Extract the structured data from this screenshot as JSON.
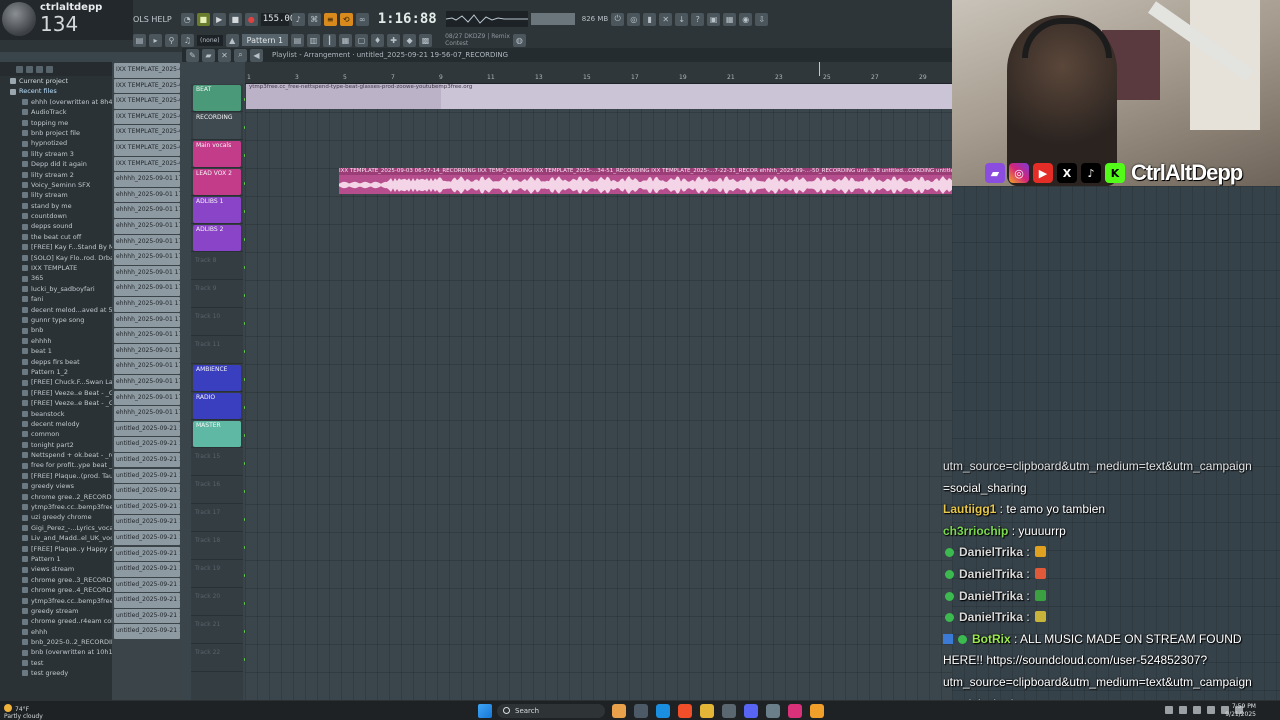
{
  "overlay": {
    "username": "ctrlaltdepp",
    "viewer_count": "134",
    "handle": "CtrlAltDepp"
  },
  "toolbar": {
    "menu_label": "OLS HELP",
    "tempo": "155.000",
    "time": "1:16:88",
    "cpu": "826 MB",
    "pattern": "Pattern 1",
    "snap": "(none)",
    "hint_line1": "08/27 DKDZ9 | Remix",
    "hint_line2": "Contest"
  },
  "playlist": {
    "title": "Playlist - Arrangement · untitled_2025-09-21 19-56-07_RECORDING",
    "bars": [
      "1",
      "3",
      "5",
      "7",
      "9",
      "11",
      "13",
      "15",
      "17",
      "19",
      "21",
      "23",
      "25",
      "27",
      "29"
    ],
    "clip_beat_label": "ytmp3free.cc_free-nettspend-type-beat-glasses-prod-zoowe-youtubemp3free.org",
    "clip_vocal_label": "IXX TEMPLATE_2025-09-03 06-57-14_RECORDING    IXX TEMP_CORDING    IXX TEMPLATE_2025-...34-51_RECORDING    IXX TEMPLATE_2025-...7-22-31_RECOR    ehhhh_2025-09-...-50_RECORDING    unti...38    untitled...CORDING    untitled_2025"
  },
  "tracks": [
    {
      "name": "BEAT",
      "color": "#4a9a7a"
    },
    {
      "name": "RECORDING",
      "color": "#3f4a50"
    },
    {
      "name": "Main vocals",
      "color": "#c33c8a"
    },
    {
      "name": "LEAD VOX 2",
      "color": "#c33c8a"
    },
    {
      "name": "ADLIBS 1",
      "color": "#8a44c8"
    },
    {
      "name": "ADLIBS 2",
      "color": "#8a44c8"
    },
    {
      "name": "Track 8",
      "color": ""
    },
    {
      "name": "Track 9",
      "color": ""
    },
    {
      "name": "Track 10",
      "color": ""
    },
    {
      "name": "Track 11",
      "color": ""
    },
    {
      "name": "AMBIENCE",
      "color": "#3a3fc0"
    },
    {
      "name": "RADIO",
      "color": "#3a3fc0"
    },
    {
      "name": "MASTER",
      "color": "#5fb8a4"
    },
    {
      "name": "Track 15",
      "color": ""
    },
    {
      "name": "Track 16",
      "color": ""
    },
    {
      "name": "Track 17",
      "color": ""
    },
    {
      "name": "Track 18",
      "color": ""
    },
    {
      "name": "Track 19",
      "color": ""
    },
    {
      "name": "Track 20",
      "color": ""
    },
    {
      "name": "Track 21",
      "color": ""
    },
    {
      "name": "Track 22",
      "color": ""
    }
  ],
  "browser": {
    "headers": [
      "Current project",
      "Recent files"
    ],
    "items": [
      "ehhh (overwritten at 8h42)",
      "AudioTrack",
      "topping me",
      "bnb project file",
      "hypnotized",
      "lilty stream 3",
      "Depp did it again",
      "lilty stream 2",
      "Voicy_Seminn SFX",
      "lilty stream",
      "stand by me",
      "countdown",
      "depps sound",
      "the beat cut off",
      "[FREE] Kay F...Stand By Me...",
      "[SOLO] Kay Flo..rod. Drbayk)",
      "IXX TEMPLATE",
      "365",
      "lucki_by_sadboyfari",
      "fani",
      "decent melod...aved at 5h27)",
      "gunnr type song",
      "bnb",
      "ehhhh",
      "beat 1",
      "depps firs beat",
      "Pattern 1_2",
      "[FREE] Chuck.F...Swan Lake_",
      "[FREE] Veeze..e Beat - _Go_1",
      "[FREE] Veeze..e Beat - _Go_",
      "beanstock",
      "decent melody",
      "common",
      "tonight part2",
      "Nettspend + ok.beat - _roll",
      "free for profit..ype beat _ss",
      "[FREE] Plaque..(prod. Taurs)",
      "greedy views",
      "chrome gree..2_RECORDING",
      "ytmp3free.cc..bemp3free.org",
      "uzi greedy chrome",
      "Gigi_Perez_-...Lyrics_vocal",
      "Liv_and_Madd..el_UK_vocal",
      "[FREE] Plaque..y Happy 2025",
      "Pattern 1",
      "views stream",
      "chrome gree..3_RECORDING",
      "chrome gree..4_RECORDING",
      "ytmp3free.cc..bemp3free.org",
      "greedy stream",
      "chrome greed..r4eam collab",
      "ehhh",
      "bnb_2025-0..2_RECORDING",
      "bnb (overwritten at 10h11)",
      "test",
      "test greedy"
    ]
  },
  "clips": [
    "IXX TEMPLATE_2025-09-...",
    "IXX TEMPLATE_2025-09-...",
    "IXX TEMPLATE_2025-09-...",
    "IXX TEMPLATE_2025-09-...",
    "IXX TEMPLATE_2025-09-...",
    "IXX TEMPLATE_2025-09-...",
    "IXX TEMPLATE_2025-09-...",
    "ehhhh_2025-09-01 17-44..",
    "ehhhh_2025-09-01 17-44..",
    "ehhhh_2025-09-01 17-45..",
    "ehhhh_2025-09-01 17-46..",
    "ehhhh_2025-09-01 17-46..",
    "ehhhh_2025-09-01 17-47..",
    "ehhhh_2025-09-01 17-47..",
    "ehhhh_2025-09-01 17-49..",
    "ehhhh_2025-09-01 17-49..",
    "ehhhh_2025-09-01 17-50..",
    "ehhhh_2025-09-01 17-52..",
    "ehhhh_2025-09-01 17-53..",
    "ehhhh_2025-09-01 17-53..",
    "ehhhh_2025-09-01 17-54..",
    "ehhhh_2025-09-01 17-55..",
    "ehhhh_2025-09-01 17-56..",
    "untitled_2025-09-21 19-..",
    "untitled_2025-09-21 19-..",
    "untitled_2025-09-21 19-..",
    "untitled_2025-09-21 19-..",
    "untitled_2025-09-21 19-..",
    "untitled_2025-09-21 19-..",
    "untitled_2025-09-21 19-..",
    "untitled_2025-09-21 19-..",
    "untitled_2025-09-21 19-..",
    "untitled_2025-09-21 19-..",
    "untitled_2025-09-21 19-..",
    "untitled_2025-09-21 19-..",
    "untitled_2025-09-21 19-..",
    "untitled_2025-09-21 19-.."
  ],
  "chat": {
    "messages": [
      {
        "user": "",
        "text": "utm_source=clipboard&utm_medium=text&utm_campaign",
        "color": "#ffffff",
        "badge": false,
        "partial": true
      },
      {
        "user": "",
        "text": "=social_sharing",
        "color": "#ffffff",
        "badge": false,
        "partial": false
      },
      {
        "user": "Lautiigg1",
        "text": "te amo yo tambien",
        "color": "#e8c84a",
        "badge": false,
        "partial": false
      },
      {
        "user": "ch3rriochip",
        "text": "yuuuurrp",
        "color": "#7bd94f",
        "badge": false,
        "partial": false
      },
      {
        "user": "DanielTrika",
        "text": "",
        "color": "#d8d8d8",
        "badge": true,
        "emote": "#e0a020",
        "partial": false
      },
      {
        "user": "DanielTrika",
        "text": "",
        "color": "#d8d8d8",
        "badge": true,
        "emote": "#e05a3a",
        "partial": false
      },
      {
        "user": "DanielTrika",
        "text": "",
        "color": "#d8d8d8",
        "badge": true,
        "emote": "#3aa040",
        "partial": false
      },
      {
        "user": "DanielTrika",
        "text": "",
        "color": "#d8d8d8",
        "badge": true,
        "emote": "#c8b43a",
        "partial": false
      },
      {
        "user": "BotRix",
        "text": "ALL MUSIC MADE ON STREAM FOUND",
        "color": "#9be84e",
        "badge": true,
        "bot": true,
        "partial": false
      },
      {
        "user": "",
        "text": "HERE!! https://soundcloud.com/user-524852307?",
        "color": "#ffffff",
        "badge": false,
        "partial": false
      },
      {
        "user": "",
        "text": "utm_source=clipboard&utm_medium=text&utm_campaign",
        "color": "#ffffff",
        "badge": false,
        "partial": false
      },
      {
        "user": "",
        "text": "=social_sharing",
        "color": "#ffffff",
        "badge": false,
        "partial": false
      }
    ]
  },
  "taskbar": {
    "weather_temp": "74°F",
    "weather_desc": "Partly cloudy",
    "search_placeholder": "Search",
    "time": "7:59 PM",
    "date": "9/21/2025"
  }
}
